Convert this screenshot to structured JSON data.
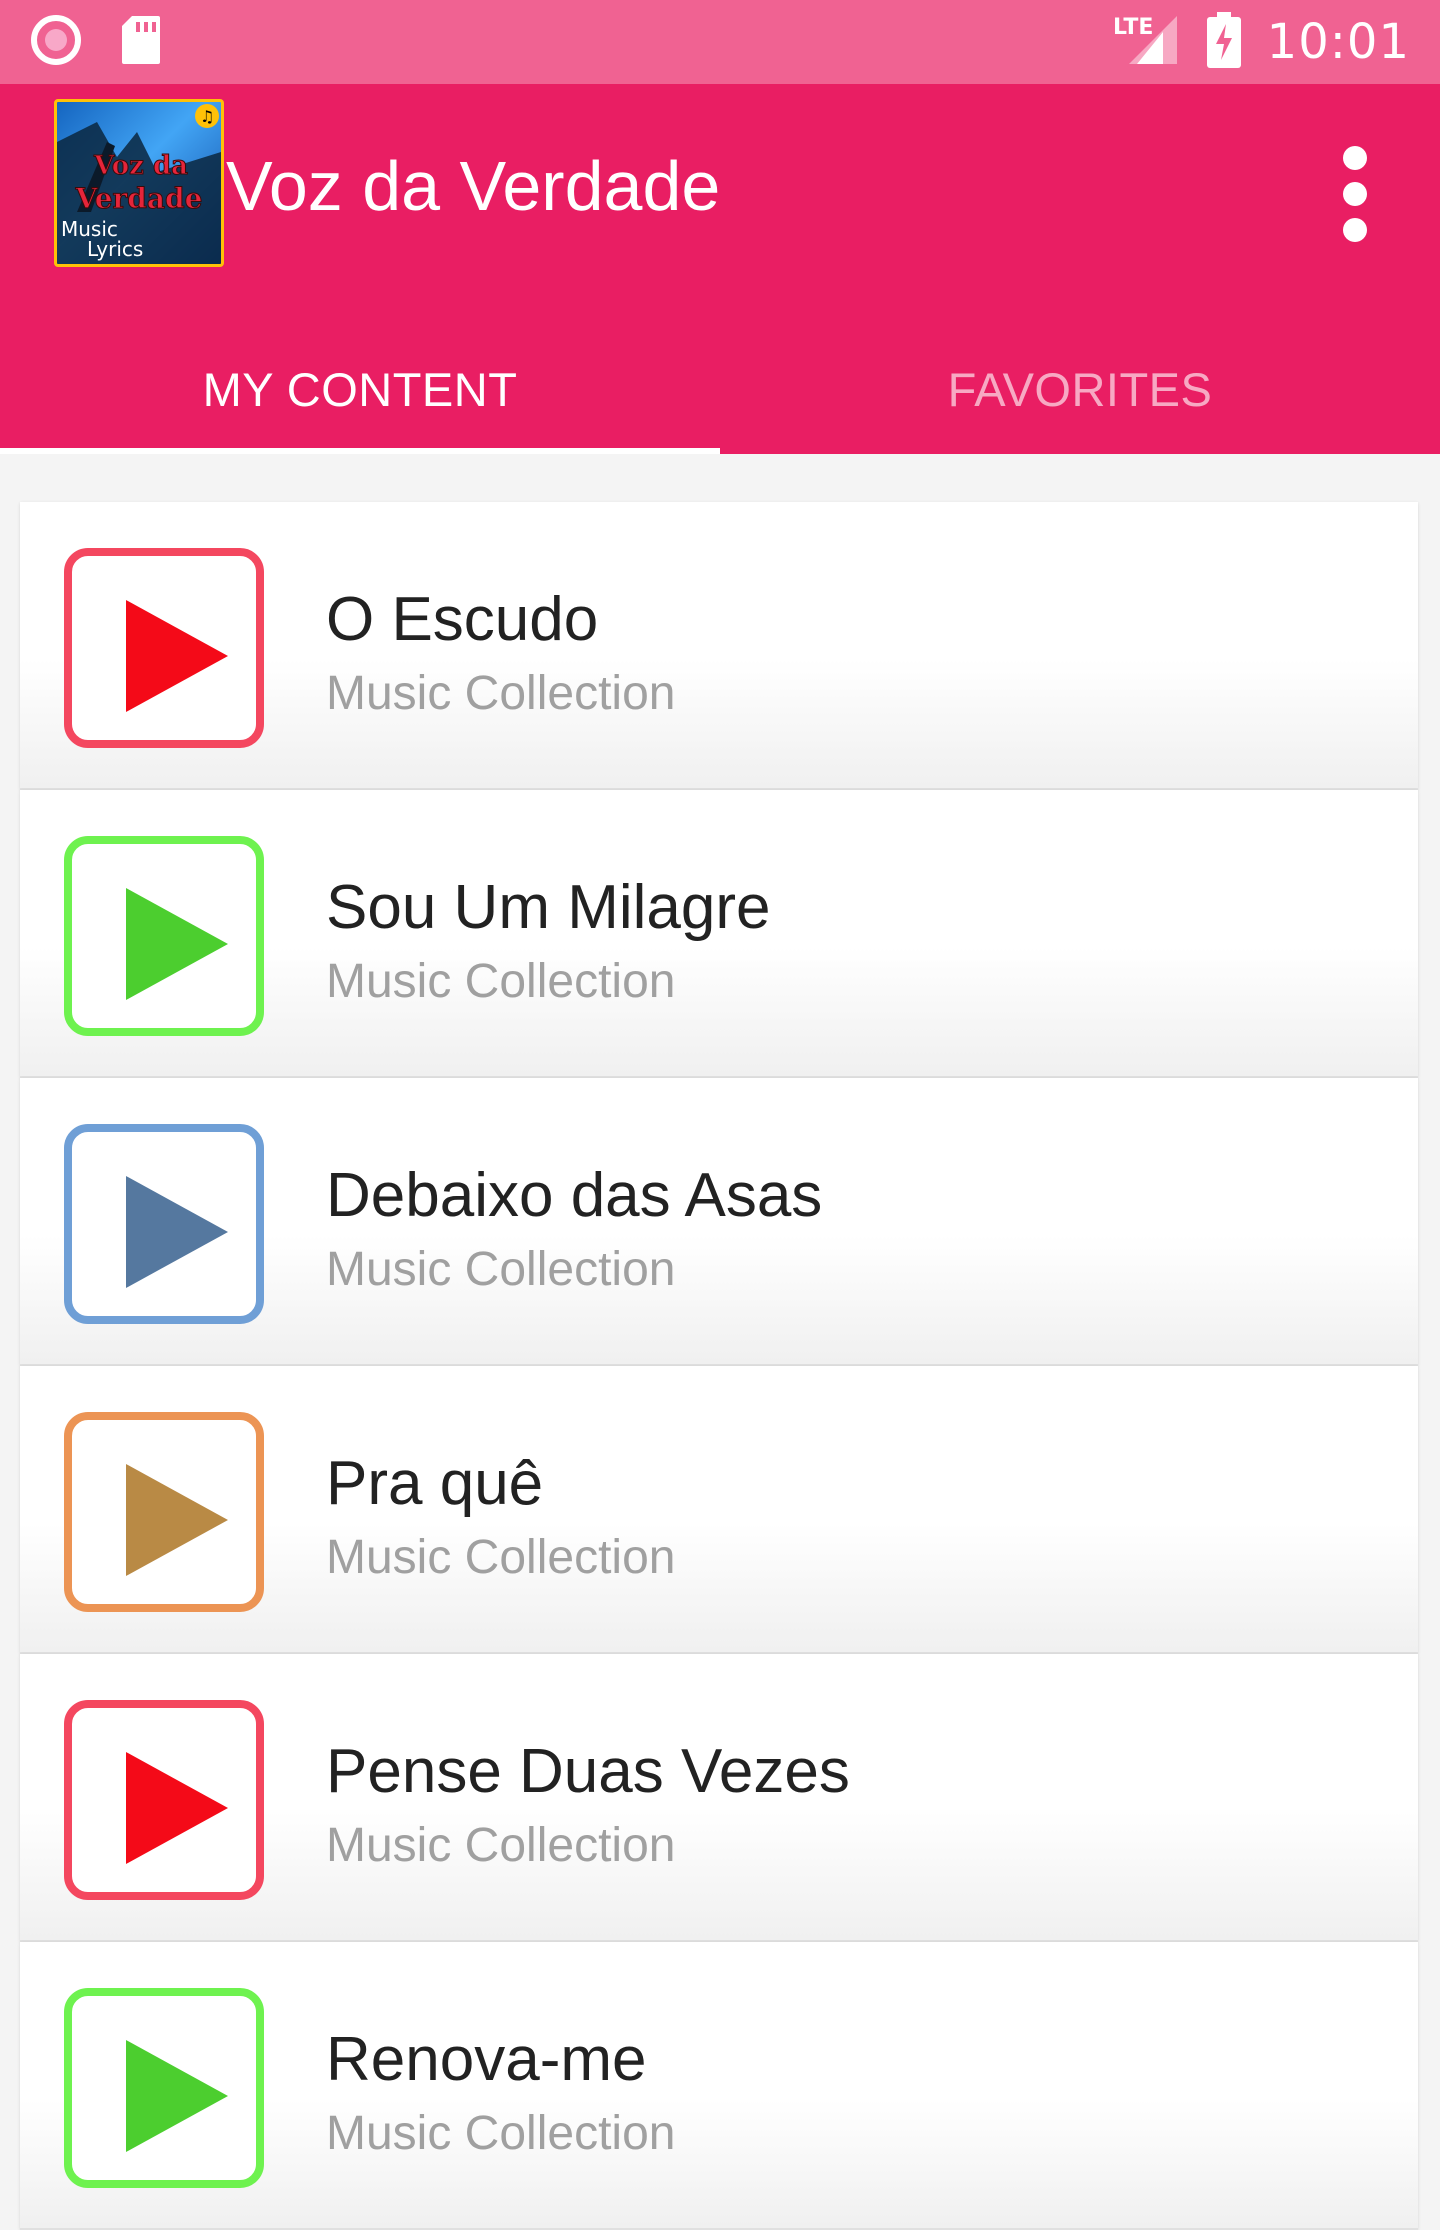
{
  "status_bar": {
    "time": "10:01",
    "network": "LTE",
    "icons": [
      "record-icon",
      "sd-card-icon",
      "signal-icon",
      "battery-charging-icon"
    ]
  },
  "app_bar": {
    "title": "Voz da Verdade",
    "logo_text": [
      "Voz da",
      "Verdade",
      "Music",
      "Lyrics"
    ],
    "menu_icon": "more-vert-icon"
  },
  "tabs": [
    {
      "label": "MY CONTENT",
      "active": true
    },
    {
      "label": "FAVORITES",
      "active": false
    }
  ],
  "songs": [
    {
      "title": "O Escudo",
      "subtitle": "Music Collection",
      "border": "#f4475f",
      "triangle": "#f40a18"
    },
    {
      "title": "Sou Um Milagre",
      "subtitle": "Music Collection",
      "border": "#6ef24f",
      "triangle": "#4cce2f"
    },
    {
      "title": "Debaixo das Asas",
      "subtitle": "Music Collection",
      "border": "#6f9fd6",
      "triangle": "#55789f"
    },
    {
      "title": "Pra quê",
      "subtitle": "Music Collection",
      "border": "#ec9454",
      "triangle": "#b98a45"
    },
    {
      "title": "Pense Duas Vezes",
      "subtitle": "Music Collection",
      "border": "#f4475f",
      "triangle": "#f40a18"
    },
    {
      "title": "Renova-me",
      "subtitle": "Music Collection",
      "border": "#6ef24f",
      "triangle": "#4cce2f"
    }
  ],
  "colors": {
    "status_bar": "#f06292",
    "app_bar": "#e91e63",
    "background": "#f4f4f4"
  }
}
